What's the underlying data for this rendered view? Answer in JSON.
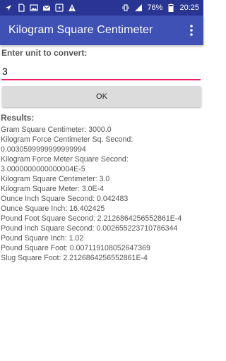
{
  "status_bar": {
    "battery": "76%",
    "time": "20:25",
    "icons_left": [
      "navigation-icon",
      "sim-card-icon",
      "image-icon",
      "mail-icon",
      "play-store-icon",
      "warning-icon"
    ],
    "icons_right": [
      "vibrate-icon",
      "network-icon",
      "battery-icon"
    ]
  },
  "app_bar": {
    "title": "Kilogram Square Centimeter",
    "menu_icon": "overflow-menu-icon"
  },
  "form": {
    "prompt": "Enter unit to convert:",
    "input_value": "3",
    "ok_label": "OK"
  },
  "results": {
    "label": "Results:",
    "lines": [
      "Gram Square Centimeter: 3000.0",
      "Kilogram Force Centimeter Sq. Second:",
      "0.0030599999999999994",
      "Kilogram Force Meter Square Second:",
      "3.0000000000000004E-5",
      "Kilogram Square Centimeter: 3.0",
      "Kilogram Square Meter: 3.0E-4",
      "Ounce Inch Square Second: 0.042483",
      "Ounce Square Inch: 16.402425",
      "Pound Foot Square Second: 2.2126864256552861E-4",
      "Pound Inch Square Second: 0.002655223710786344",
      "Pound Square Inch: 1.02",
      "Pound Square Foot: 0.007119108052647369",
      "Slug Square Foot: 2.2126864256552861E-4"
    ]
  },
  "colors": {
    "status_bar": "#283593",
    "app_bar": "#3f51b5",
    "accent_underline": "#e91e63",
    "button_bg": "#dcdcdc"
  }
}
